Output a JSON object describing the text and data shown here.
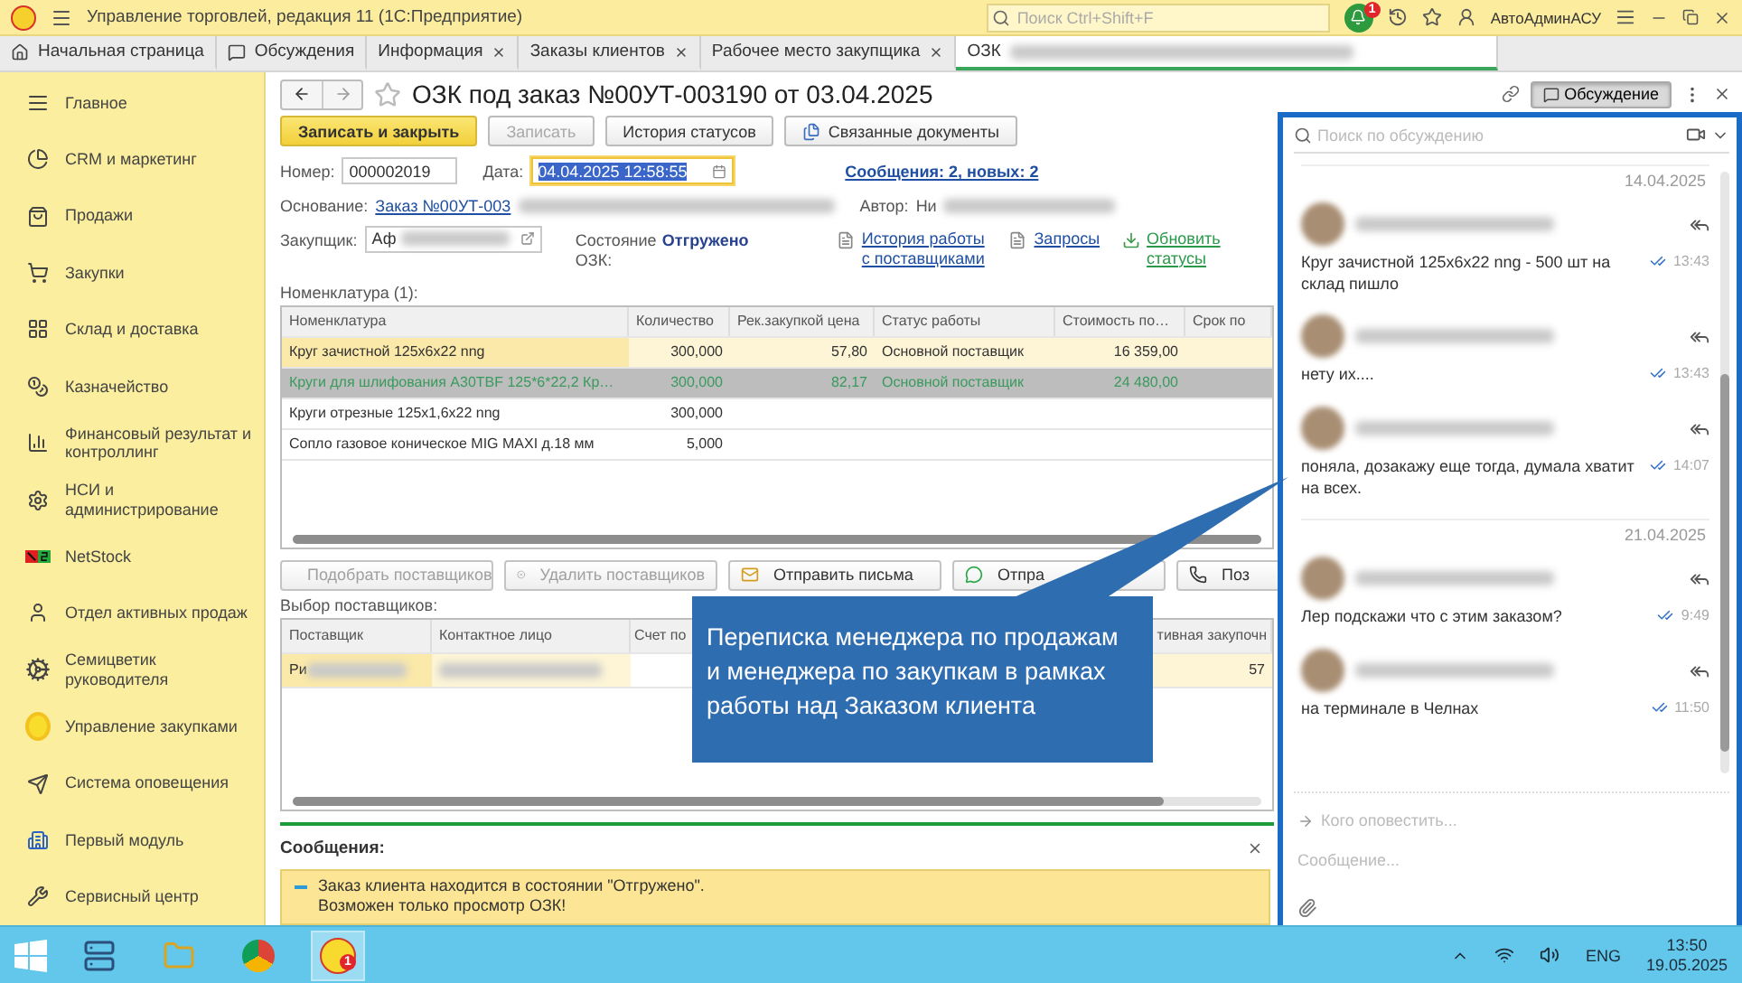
{
  "app_bar": {
    "title": "Управление торговлей, редакция 11  (1С:Предприятие)",
    "search": {
      "placeholder": "Поиск Ctrl+Shift+F"
    },
    "notifications": "1",
    "user": "АвтоАдминАСУ"
  },
  "tabs": [
    {
      "label": "Начальная страница",
      "kind": "home",
      "selected": false,
      "closable": false
    },
    {
      "label": "Обсуждения",
      "kind": "chat",
      "selected": false,
      "closable": false
    },
    {
      "label": "Информация",
      "kind": "plain",
      "selected": false,
      "closable": true
    },
    {
      "label": "Заказы клиентов",
      "kind": "plain",
      "selected": false,
      "closable": true
    },
    {
      "label": "Рабочее место закупщика",
      "kind": "plain",
      "selected": false,
      "closable": true
    },
    {
      "label": "ОЗК",
      "kind": "redacted",
      "selected": true,
      "closable": false
    }
  ],
  "sidebar": {
    "items": [
      "Главное",
      "CRM и маркетинг",
      "Продажи",
      "Закупки",
      "Склад и доставка",
      "Казначейство",
      "Финансовый результат и контроллинг",
      "НСИ и администрирование",
      "NetStock",
      "Отдел активных продаж",
      "Семицветик руководителя",
      "Управление закупками",
      "Система оповещения",
      "Первый модуль",
      "Сервисный центр"
    ]
  },
  "document": {
    "title": "ОЗК под заказ №00УТ-003190 от 03.04.2025",
    "discussion_button": {
      "label": "Обсуждение",
      "on": true
    },
    "toolbar": [
      {
        "label": "Записать и закрыть",
        "kind": "primary",
        "disabled": false
      },
      {
        "label": "Записать",
        "kind": "plain",
        "disabled": true
      },
      {
        "label": "История статусов",
        "kind": "plain",
        "disabled": false
      },
      {
        "label": "Связанные документы",
        "kind": "linked",
        "disabled": false
      }
    ],
    "number": {
      "label": "Номер:",
      "value": "000002019"
    },
    "date": {
      "label": "Дата:",
      "value": "04.04.2025 12:58:55",
      "selected": true
    },
    "messages_link": "Сообщения: 2, новых: 2",
    "basis": {
      "label": "Основание:",
      "value": "Заказ №00УТ-003"
    },
    "author": {
      "label": "Автор:",
      "value": "Ни"
    },
    "buyer": {
      "label": "Закупщик:",
      "value": "Аф"
    },
    "state": {
      "label": "Состояние ОЗК:",
      "value": "Отгружено"
    },
    "links": [
      {
        "label": "История работы с поставщиками",
        "kind": "history"
      },
      {
        "label": "Запросы",
        "kind": "requests"
      },
      {
        "label": "Обновить статусы",
        "kind": "update"
      }
    ],
    "items_table": {
      "title": "Номенклатура (1):",
      "columns": [
        "Номенклатура",
        "Количество",
        "Рек.закупкой цена",
        "Статус работы",
        "Стоимость по…",
        "Срок по"
      ],
      "rows": [
        {
          "cells": [
            "Круг зачистной 125х6х22 nng",
            "300,000",
            "57,80",
            "Основной поставщик",
            "16 359,00"
          ],
          "selected": true,
          "marked": false
        },
        {
          "cells": [
            "Круги для шлифования А30TBF 125*6*22,2 Кр…",
            "300,000",
            "82,17",
            "Основной поставщик",
            "24 480,00"
          ],
          "selected": false,
          "marked": true
        },
        {
          "cells": [
            "Круги отрезные 125х1,6х22 nng",
            "300,000"
          ],
          "selected": false,
          "marked": false
        },
        {
          "cells": [
            "Сопло газовое коническое MIG MAXI д.18 мм",
            "5,000"
          ],
          "selected": false,
          "marked": false
        }
      ]
    },
    "supplier_buttons": [
      {
        "label": "Подобрать поставщиков",
        "kind": "add",
        "disabled": true
      },
      {
        "label": "Удалить поставщиков",
        "kind": "remove",
        "disabled": true
      },
      {
        "label": "Отправить письма",
        "kind": "mail",
        "disabled": false
      },
      {
        "label": "Отпра",
        "kind": "whatsapp",
        "disabled": false
      },
      {
        "label": "Поз",
        "kind": "phone",
        "disabled": false
      }
    ],
    "suppliers_table": {
      "title": "Выбор поставщиков:",
      "columns": [
        "Поставщик",
        "Контактное лицо",
        "Счет по",
        "тивная закупочн"
      ],
      "rows": [
        {
          "supplier": "Ри",
          "price": "57",
          "selected": true
        }
      ]
    },
    "messages": {
      "title": "Сообщения:",
      "lines": [
        "Заказ клиента находится в состоянии \"Отгружено\".",
        "Возможен только просмотр ОЗК!"
      ]
    }
  },
  "discussion": {
    "search": {
      "placeholder": "Поиск по обсуждению"
    },
    "days": [
      {
        "date": "14.04.2025",
        "messages": [
          {
            "text": "Круг зачистной 125х6х22 nng - 500 шт на склад пишло",
            "time": "13:43"
          },
          {
            "text": "нету их....",
            "time": "13:43"
          },
          {
            "text": "поняла, дозакажу еще тогда, думала хватит на всех.",
            "time": "14:07"
          }
        ]
      },
      {
        "date": "21.04.2025",
        "messages": [
          {
            "text": "Лер подскажи что с этим заказом?",
            "time": "9:49"
          },
          {
            "text": "на терминале в Челнах",
            "time": "11:50"
          }
        ]
      }
    ],
    "recipients": {
      "placeholder": "Кого оповестить..."
    },
    "compose": {
      "placeholder": "Сообщение..."
    }
  },
  "callout": {
    "text": "Переписка менеджера по продажам и менеджера по закупкам в рамках работы над Заказом клиента"
  },
  "taskbar": {
    "badge": "1",
    "language": "ENG",
    "time": "13:50",
    "date": "19.05.2025"
  }
}
